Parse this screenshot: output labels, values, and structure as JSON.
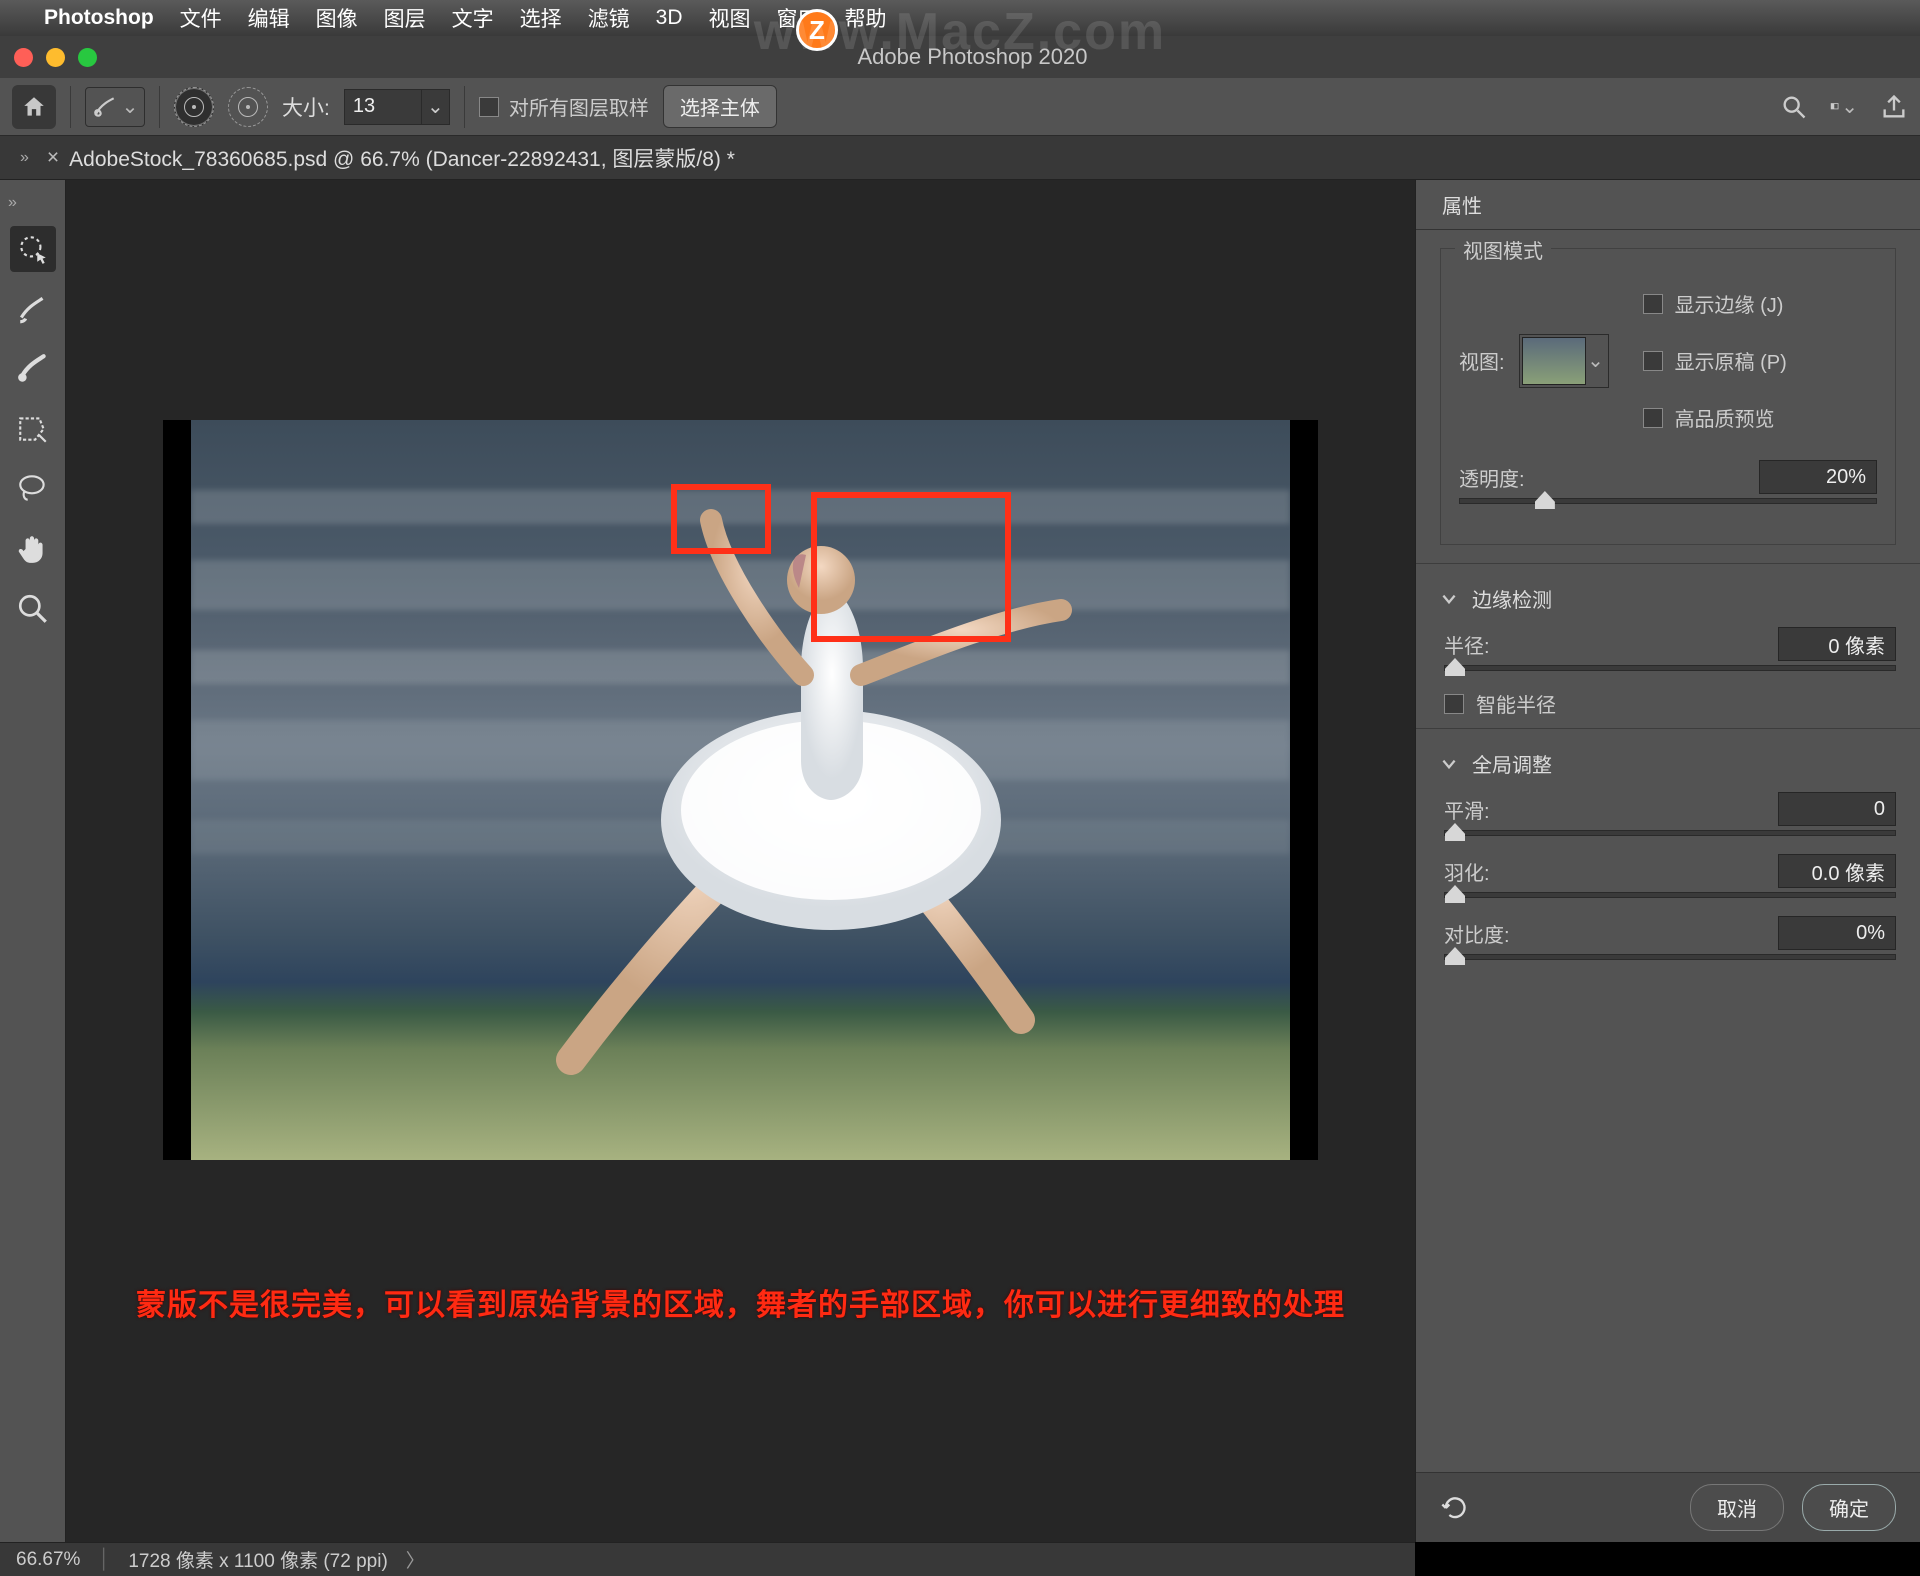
{
  "menubar": {
    "app": "Photoshop",
    "items": [
      "文件",
      "编辑",
      "图像",
      "图层",
      "文字",
      "选择",
      "滤镜",
      "3D",
      "视图",
      "窗口",
      "帮助"
    ]
  },
  "window": {
    "title": "Adobe Photoshop 2020"
  },
  "optionsbar": {
    "size_label": "大小:",
    "size_value": "13",
    "sample_all_label": "对所有图层取样",
    "select_subject": "选择主体"
  },
  "doctab": {
    "title": "AdobeStock_78360685.psd @ 66.7% (Dancer-22892431, 图层蒙版/8) *"
  },
  "canvas": {
    "annotation": "蒙版不是很完美，可以看到原始背景的区域，舞者的手部区域，你可以进行更细致的处理",
    "watermark": "www.MacZ.com"
  },
  "panel": {
    "tab": "属性",
    "view_mode_title": "视图模式",
    "view_label": "视图:",
    "show_edges": "显示边缘 (J)",
    "show_original": "显示原稿 (P)",
    "hq_preview": "高品质预览",
    "opacity_label": "透明度:",
    "opacity_value": "20%",
    "edge_section": "边缘检测",
    "radius_label": "半径:",
    "radius_value": "0 像素",
    "smart_radius": "智能半径",
    "global_section": "全局调整",
    "smooth_label": "平滑:",
    "smooth_value": "0",
    "feather_label": "羽化:",
    "feather_value": "0.0 像素",
    "contrast_label": "对比度:",
    "contrast_value": "0%",
    "cancel": "取消",
    "ok": "确定"
  },
  "statusbar": {
    "zoom": "66.67%",
    "dims": "1728 像素 x 1100 像素 (72 ppi)"
  }
}
